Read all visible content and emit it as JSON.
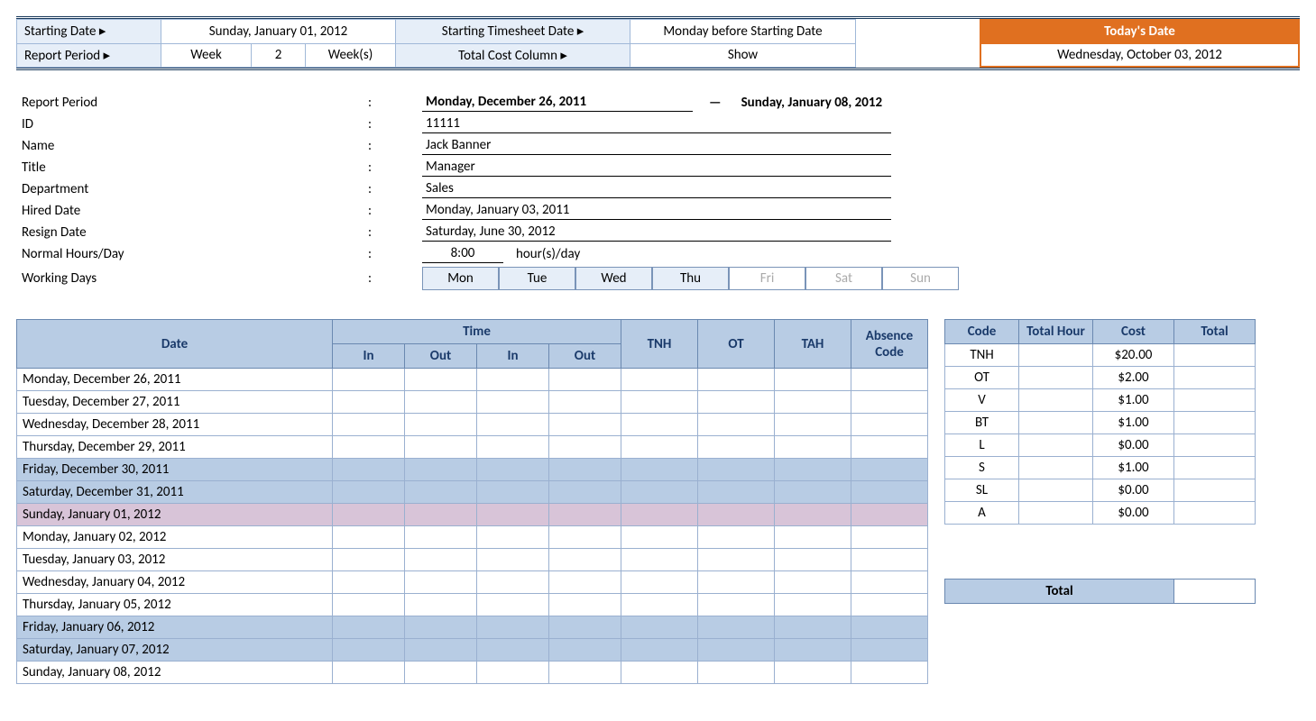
{
  "top": {
    "starting_date_label": "Starting Date ▸",
    "starting_date_value": "Sunday, January 01, 2012",
    "starting_ts_label": "Starting Timesheet Date ▸",
    "starting_ts_value": "Monday before Starting Date",
    "report_period_label": "Report Period ▸",
    "rp_week_label": "Week",
    "rp_week_num": "2",
    "rp_week_unit": "Week(s)",
    "total_cost_label": "Total Cost Column ▸",
    "total_cost_value": "Show",
    "today_label": "Today's Date",
    "today_value": "Wednesday, October 03, 2012"
  },
  "info": {
    "labels": {
      "report_period": "Report Period",
      "id": "ID",
      "name": "Name",
      "title": "Title",
      "department": "Department",
      "hired": "Hired Date",
      "resign": "Resign Date",
      "normal": "Normal Hours/Day",
      "working": "Working Days"
    },
    "report_from": "Monday, December 26, 2011",
    "report_to": "Sunday, January 08, 2012",
    "id": "11111",
    "name": "Jack Banner",
    "title": "Manager",
    "department": "Sales",
    "hired": "Monday, January 03, 2011",
    "resign": "Saturday, June 30, 2012",
    "normal_hours": "8:00",
    "normal_unit": "hour(s)/day",
    "days": [
      "Mon",
      "Tue",
      "Wed",
      "Thu",
      "Fri",
      "Sat",
      "Sun"
    ]
  },
  "ts_headers": {
    "date": "Date",
    "time": "Time",
    "in": "In",
    "out": "Out",
    "tnh": "TNH",
    "ot": "OT",
    "tah": "TAH",
    "absence": "Absence Code"
  },
  "ts_rows": [
    {
      "date": "Monday, December 26, 2011",
      "cls": ""
    },
    {
      "date": "Tuesday, December 27, 2011",
      "cls": ""
    },
    {
      "date": "Wednesday, December 28, 2011",
      "cls": ""
    },
    {
      "date": "Thursday, December 29, 2011",
      "cls": ""
    },
    {
      "date": "Friday, December 30, 2011",
      "cls": "row-wknd"
    },
    {
      "date": "Saturday, December 31, 2011",
      "cls": "row-wknd"
    },
    {
      "date": "Sunday, January 01, 2012",
      "cls": "row-sun"
    },
    {
      "date": "Monday, January 02, 2012",
      "cls": ""
    },
    {
      "date": "Tuesday, January 03, 2012",
      "cls": ""
    },
    {
      "date": "Wednesday, January 04, 2012",
      "cls": ""
    },
    {
      "date": "Thursday, January 05, 2012",
      "cls": ""
    },
    {
      "date": "Friday, January 06, 2012",
      "cls": "row-wknd"
    },
    {
      "date": "Saturday, January 07, 2012",
      "cls": "row-wknd"
    },
    {
      "date": "Sunday, January 08, 2012",
      "cls": ""
    }
  ],
  "code_headers": {
    "code": "Code",
    "total_hour": "Total Hour",
    "cost": "Cost",
    "total": "Total"
  },
  "code_rows": [
    {
      "code": "TNH",
      "cost": "$20.00"
    },
    {
      "code": "OT",
      "cost": "$2.00"
    },
    {
      "code": "V",
      "cost": "$1.00"
    },
    {
      "code": "BT",
      "cost": "$1.00"
    },
    {
      "code": "L",
      "cost": "$0.00"
    },
    {
      "code": "S",
      "cost": "$1.00"
    },
    {
      "code": "SL",
      "cost": "$0.00"
    },
    {
      "code": "A",
      "cost": "$0.00"
    }
  ],
  "total_label": "Total"
}
